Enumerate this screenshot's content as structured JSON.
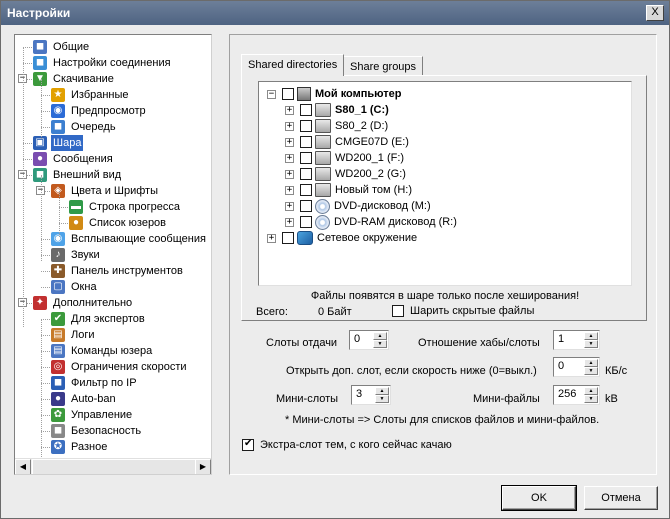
{
  "window": {
    "title": "Настройки",
    "close_label": "X"
  },
  "tree": {
    "items": [
      {
        "label": "Общие",
        "icon": "general-icon"
      },
      {
        "label": "Настройки соединения",
        "icon": "connection-icon"
      },
      {
        "label": "Скачивание",
        "icon": "download-icon"
      },
      {
        "label": "Избранные",
        "icon": "star-icon"
      },
      {
        "label": "Предпросмотр",
        "icon": "preview-icon"
      },
      {
        "label": "Очередь",
        "icon": "queue-icon"
      },
      {
        "label": "Шара",
        "icon": "share-icon",
        "selected": true
      },
      {
        "label": "Сообщения",
        "icon": "messages-icon"
      },
      {
        "label": "Внешний вид",
        "icon": "appearance-icon"
      },
      {
        "label": "Цвета и Шрифты",
        "icon": "colors-icon"
      },
      {
        "label": "Строка прогресса",
        "icon": "progressbar-icon"
      },
      {
        "label": "Список юзеров",
        "icon": "userlist-icon"
      },
      {
        "label": "Всплывающие сообщения",
        "icon": "popup-icon"
      },
      {
        "label": "Звуки",
        "icon": "sounds-icon"
      },
      {
        "label": "Панель инструментов",
        "icon": "toolbar-icon"
      },
      {
        "label": "Окна",
        "icon": "windows-icon"
      },
      {
        "label": "Дополнительно",
        "icon": "advanced-icon"
      },
      {
        "label": "Для экспертов",
        "icon": "experts-icon"
      },
      {
        "label": "Логи",
        "icon": "logs-icon"
      },
      {
        "label": "Команды юзера",
        "icon": "usercommands-icon"
      },
      {
        "label": "Ограничения скорости",
        "icon": "speedlimit-icon"
      },
      {
        "label": "Фильтр по IP",
        "icon": "ipfilter-icon"
      },
      {
        "label": "Auto-ban",
        "icon": "autoban-icon"
      },
      {
        "label": "Управление",
        "icon": "control-icon"
      },
      {
        "label": "Безопасность",
        "icon": "security-icon"
      },
      {
        "label": "Разное",
        "icon": "misc-icon"
      }
    ]
  },
  "tabs": {
    "shared": "Shared directories",
    "groups": "Share groups"
  },
  "dirs": {
    "root": "Мой компьютер",
    "drives": [
      {
        "label": "S80_1 (C:)",
        "icon": "hdd-icon",
        "bold": true
      },
      {
        "label": "S80_2 (D:)",
        "icon": "hdd-icon"
      },
      {
        "label": "CMGE07D (E:)",
        "icon": "hdd-icon"
      },
      {
        "label": "WD200_1 (F:)",
        "icon": "hdd-icon"
      },
      {
        "label": "WD200_2 (G:)",
        "icon": "hdd-icon"
      },
      {
        "label": "Новый том (H:)",
        "icon": "hdd-icon"
      },
      {
        "label": "DVD-дисковод (M:)",
        "icon": "dvd-icon"
      },
      {
        "label": "DVD-RAM дисковод (R:)",
        "icon": "dvd-icon"
      }
    ],
    "network": "Сетевое окружение"
  },
  "share": {
    "note": "Файлы появятся в шаре только после хеширования!",
    "total_label": "Всего:",
    "total_value": "0 Байт",
    "hidden_label": "Шарить скрытые файлы"
  },
  "settings": {
    "slots_label": "Слоты отдачи",
    "slots_value": "0",
    "hub_ratio_label": "Отношение хабы/слоты",
    "hub_ratio_value": "1",
    "extra_slot_label": "Открыть доп. слот, если скорость ниже (0=выкл.)",
    "extra_slot_value": "0",
    "extra_slot_unit": "КБ/с",
    "mini_slots_label": "Мини-слоты",
    "mini_slots_value": "3",
    "mini_files_label": "Мини-файлы",
    "mini_files_value": "256",
    "mini_files_unit": "kB",
    "mini_note": "* Мини-слоты => Слоты для списков файлов и мини-файлов.",
    "extra_now_label": "Экстра-слот тем, с кого сейчас качаю",
    "extra_now_checked": true
  },
  "buttons": {
    "ok": "OK",
    "cancel": "Отмена"
  }
}
